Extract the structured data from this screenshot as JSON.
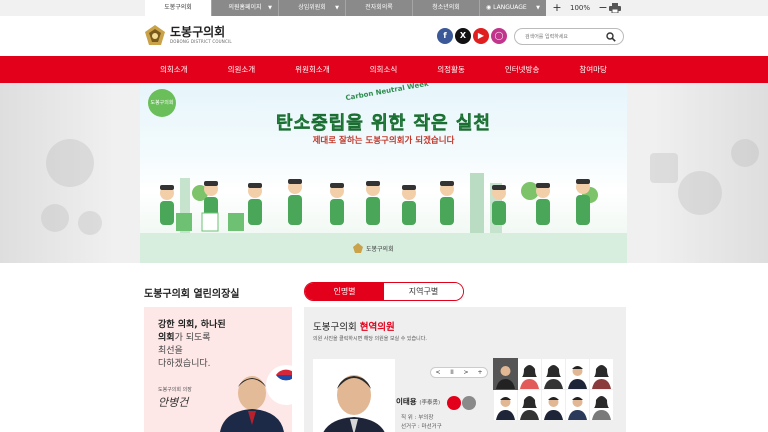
{
  "topbar": {
    "tabs": [
      {
        "label": "도봉구의회",
        "has_caret": false
      },
      {
        "label": "의원홈페이지",
        "has_caret": true
      },
      {
        "label": "상임위원회",
        "has_caret": true
      },
      {
        "label": "전자회의록",
        "has_caret": false
      },
      {
        "label": "청소년의회",
        "has_caret": false
      }
    ],
    "language_label": "LANGUAGE",
    "zoom_in": "+",
    "zoom_value": "100%",
    "zoom_out": "−"
  },
  "header": {
    "logo_ko": "도봉구의회",
    "logo_en": "DOBONG DISTRICT COUNCIL",
    "search_placeholder": "검색어를 입력하세요"
  },
  "nav": {
    "items": [
      "의회소개",
      "의원소개",
      "위원회소개",
      "의회소식",
      "의정활동",
      "인터넷방송",
      "참여마당"
    ]
  },
  "hero": {
    "badge": "도봉구의회",
    "eng_text": "Carbon Neutral Week",
    "title": "탄소중립을 위한 작은 실천",
    "subtitle": "제대로 잘하는 도봉구의회가 되겠습니다",
    "footer_logo": "도봉구의회"
  },
  "open_office": {
    "title": "도봉구의회 열린의장실",
    "line1": "강한 의회, 하나된",
    "line2_bold": "의회",
    "line2_rest": "가 되도록",
    "line3": "최선을",
    "line4": "다하겠습니다.",
    "role": "도봉구의회 의장",
    "signature": "안병건"
  },
  "members": {
    "tabs": [
      "인명별",
      "지역구별"
    ],
    "title_prefix": "도봉구의회 ",
    "title_highlight": "현역의원",
    "desc": "의원 사진을 클릭하시면 해당 의원을 보실 수 있습니다.",
    "controls": [
      "<",
      "II",
      ">",
      "+"
    ],
    "name": "이태용",
    "name_hanja": "(李泰勇)",
    "position": "직 위 : 부의장",
    "district": "선거구 : 마선거구"
  },
  "colors": {
    "primary_red": "#e3001b",
    "hero_green": "#38a652",
    "topbar_gray": "#8a8a8a"
  }
}
